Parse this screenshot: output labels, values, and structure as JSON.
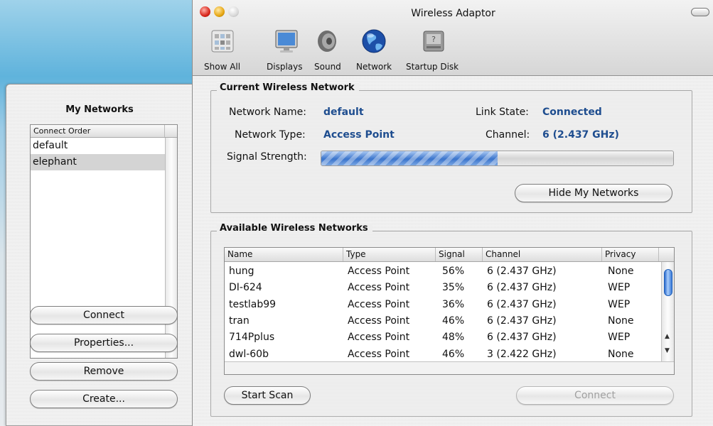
{
  "window": {
    "title": "Wireless Adaptor"
  },
  "toolbar": {
    "items": [
      {
        "label": "Show All",
        "icon": "show-all-icon"
      },
      {
        "label": "Displays",
        "icon": "displays-icon"
      },
      {
        "label": "Sound",
        "icon": "sound-icon"
      },
      {
        "label": "Network",
        "icon": "network-globe-icon"
      },
      {
        "label": "Startup Disk",
        "icon": "startup-disk-icon"
      }
    ]
  },
  "my_networks": {
    "title": "My Networks",
    "column_header": "Connect Order",
    "items": [
      {
        "name": "default",
        "selected": false
      },
      {
        "name": "elephant",
        "selected": true
      }
    ],
    "buttons": {
      "connect": "Connect",
      "properties": "Properties...",
      "remove": "Remove",
      "create": "Create..."
    }
  },
  "current_network": {
    "title": "Current Wireless Network",
    "network_name_label": "Network Name:",
    "network_name": "default",
    "network_type_label": "Network Type:",
    "network_type": "Access Point",
    "link_state_label": "Link State:",
    "link_state": "Connected",
    "channel_label": "Channel:",
    "channel": "6 (2.437 GHz)",
    "signal_strength_label": "Signal Strength:",
    "signal_strength_fraction": 0.5,
    "hide_button": "Hide My Networks"
  },
  "available_networks": {
    "title": "Available Wireless Networks",
    "columns": [
      "Name",
      "Type",
      "Signal",
      "Channel",
      "Privacy"
    ],
    "rows": [
      [
        "hung",
        "Access Point",
        "56%",
        "6 (2.437 GHz)",
        "None"
      ],
      [
        "DI-624",
        "Access Point",
        "35%",
        "6 (2.437 GHz)",
        "WEP"
      ],
      [
        "testlab99",
        "Access Point",
        "36%",
        "6 (2.437 GHz)",
        "WEP"
      ],
      [
        "tran",
        "Access Point",
        "46%",
        "6 (2.437 GHz)",
        "None"
      ],
      [
        "714Pplus",
        "Access Point",
        "48%",
        "6 (2.437 GHz)",
        "WEP"
      ],
      [
        "dwl-60b",
        "Access Point",
        "46%",
        "3 (2.422 GHz)",
        "None"
      ]
    ],
    "start_scan_button": "Start Scan",
    "connect_button": "Connect"
  },
  "colors": {
    "value_text": "#1e4d8f",
    "signal_fill": "#5b8fd6",
    "close": "#d8261b",
    "minimize": "#e7a612"
  }
}
